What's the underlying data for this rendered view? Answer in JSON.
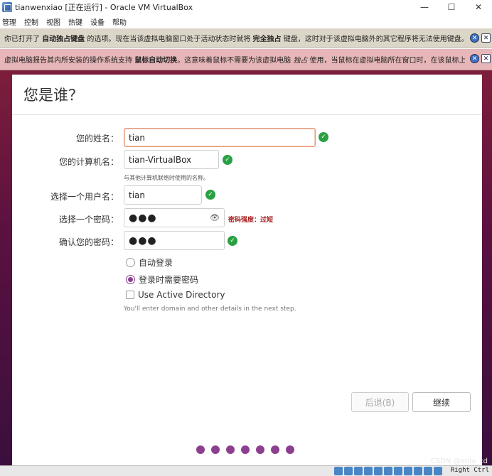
{
  "window": {
    "title": "tianwenxiao [正在运行] - Oracle VM VirtualBox",
    "minimize": "—",
    "maximize": "☐",
    "close": "✕"
  },
  "menu": [
    "管理",
    "控制",
    "视图",
    "热键",
    "设备",
    "帮助"
  ],
  "notices": [
    {
      "parts": [
        "你已打开了 ",
        "自动独占键盘",
        " 的选项。现在当该虚拟电脑窗口处于活动状态时就将 ",
        "完全独占",
        " 键盘，这时对于该虚拟电脑外的其它程序将无法使用键盘。当"
      ]
    },
    {
      "parts": [
        "虚拟电脑报告其内所安装的操作系统支持 ",
        "鼠标自动切换",
        "。这意味着鼠标不需要为该虚拟电脑 ",
        "独占",
        " 使用，当鼠标在虚拟电脑所在窗口时，在该鼠标上的"
      ]
    }
  ],
  "dialog": {
    "title": "您是谁？",
    "name_label": "您的姓名：",
    "name_value": "tian",
    "computer_label": "您的计算机名：",
    "computer_value": "tian-VirtualBox",
    "computer_hint": "与其他计算机联络时使用的名称。",
    "username_label": "选择一个用户名：",
    "username_value": "tian",
    "password_label": "选择一个密码：",
    "password_value": "●●●",
    "strength": "密码强度：过短",
    "confirm_label": "确认您的密码：",
    "confirm_value": "●●●",
    "auto_login": "自动登录",
    "require_password": "登录时需要密码",
    "active_directory": "Use Active Directory",
    "ad_hint": "You'll enter domain and other details in the next step.",
    "back_label": "后退(B)",
    "continue_label": "继续",
    "check_mark": "✓",
    "eye": "👁"
  },
  "status": {
    "host_key": "Right Ctrl",
    "watermark": "CSDN @milu_cd"
  },
  "colors": {
    "accent": "#8c3f8f",
    "ok": "#2aa043",
    "danger": "#a31a1a"
  }
}
